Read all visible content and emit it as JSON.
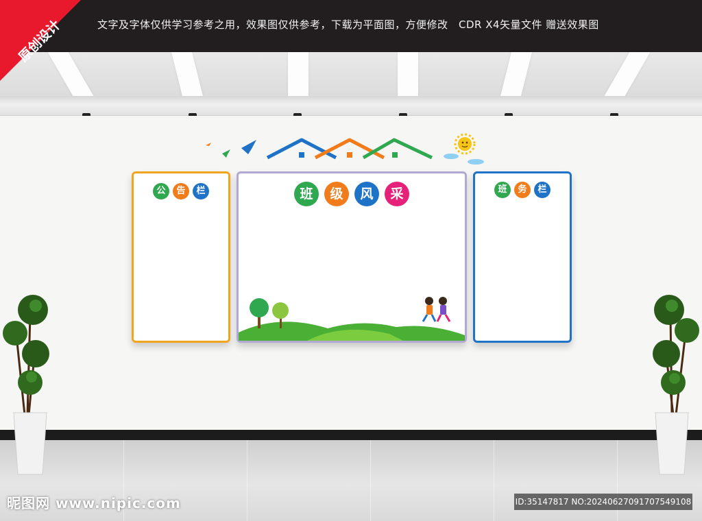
{
  "header": {
    "notice": "文字及字体仅供学习参考之用，效果图仅供参考，下载为平面图，方便修改　CDR X4矢量文件  赠送效果图",
    "corner_badge": "原创设计",
    "background": "#221e1f",
    "corner_color": "#e8192c"
  },
  "boards": {
    "left": {
      "title_chars": [
        "公",
        "告",
        "栏"
      ],
      "badge_colors": [
        "#2fa84f",
        "#f07c1c",
        "#1f73c6"
      ],
      "border_color": "#f0a51e"
    },
    "center": {
      "title_chars": [
        "班",
        "级",
        "风",
        "采"
      ],
      "badge_colors": [
        "#2fa84f",
        "#f07c1c",
        "#1f73c6",
        "#e6217a"
      ],
      "border_color": "#b1a8d4"
    },
    "right": {
      "title_chars": [
        "班",
        "务",
        "栏"
      ],
      "badge_colors": [
        "#2fa84f",
        "#f07c1c",
        "#1f73c6"
      ],
      "border_color": "#1f73c6"
    }
  },
  "decor": {
    "roof_colors": [
      "#1f73c6",
      "#f07c1c",
      "#2fa84f"
    ],
    "bird_colors": [
      "#f07c1c",
      "#2fa84f",
      "#1f73c6"
    ],
    "sun_color": "#f5c518",
    "icons": [
      "potted-topiary-icon",
      "house-roof-icon",
      "bird-icon",
      "sun-icon",
      "cloud-icon",
      "tree-icon",
      "running-kids-icon"
    ]
  },
  "footer": {
    "watermark": "昵图网 www.nipic.com",
    "id_text": "ID:35147817 NO:20240627091707549108"
  }
}
